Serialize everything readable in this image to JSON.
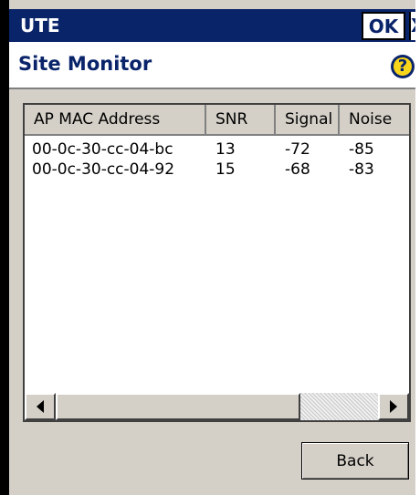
{
  "window": {
    "title": "UTE",
    "ok_label": "OK",
    "close_label": "X"
  },
  "header": {
    "page_title": "Site Monitor",
    "help_icon": "question-mark-icon",
    "help_glyph": "?"
  },
  "list": {
    "columns": [
      "AP MAC Address",
      "SNR",
      "Signal",
      "Noise"
    ],
    "rows": [
      [
        "00-0c-30-cc-04-bc",
        "13",
        "-72",
        "-85"
      ],
      [
        "00-0c-30-cc-04-92",
        "15",
        "-68",
        "-83"
      ]
    ]
  },
  "buttons": {
    "back_label": "Back"
  },
  "colors": {
    "titlebar": "#0a246a",
    "face": "#d4d0c8",
    "help_fill": "#f7d51a"
  }
}
